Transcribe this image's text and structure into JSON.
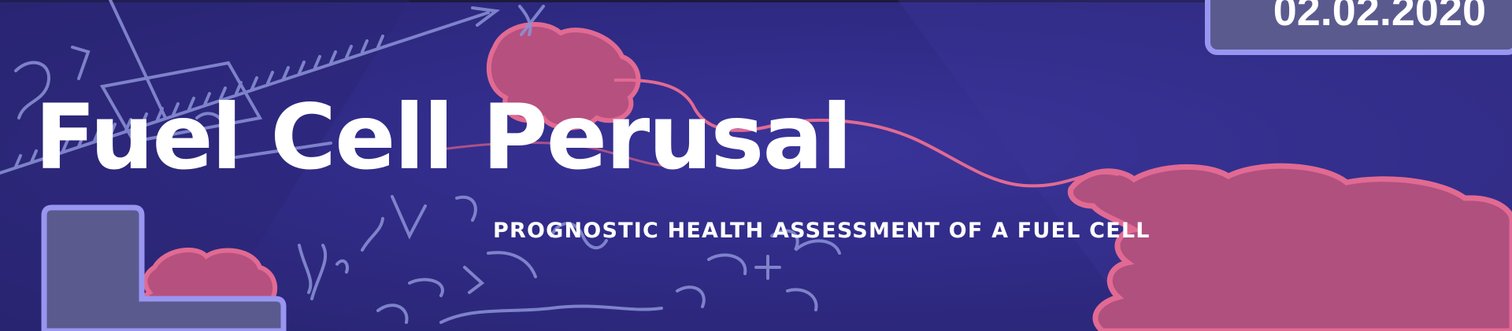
{
  "banner": {
    "title": "Fuel Cell Perusal",
    "subtitle": "PROGNOSTIC HEALTH ASSESSMENT OF A FUEL CELL",
    "date": "02.02.2020"
  },
  "colors": {
    "background": "#2d2a7c",
    "blob": "#c8547f",
    "blob_outline": "#e16a93",
    "sketch_lines": "#8c92d8",
    "badge_fill": "#5b5a8f",
    "badge_border": "#9896f0",
    "text": "#ffffff"
  }
}
